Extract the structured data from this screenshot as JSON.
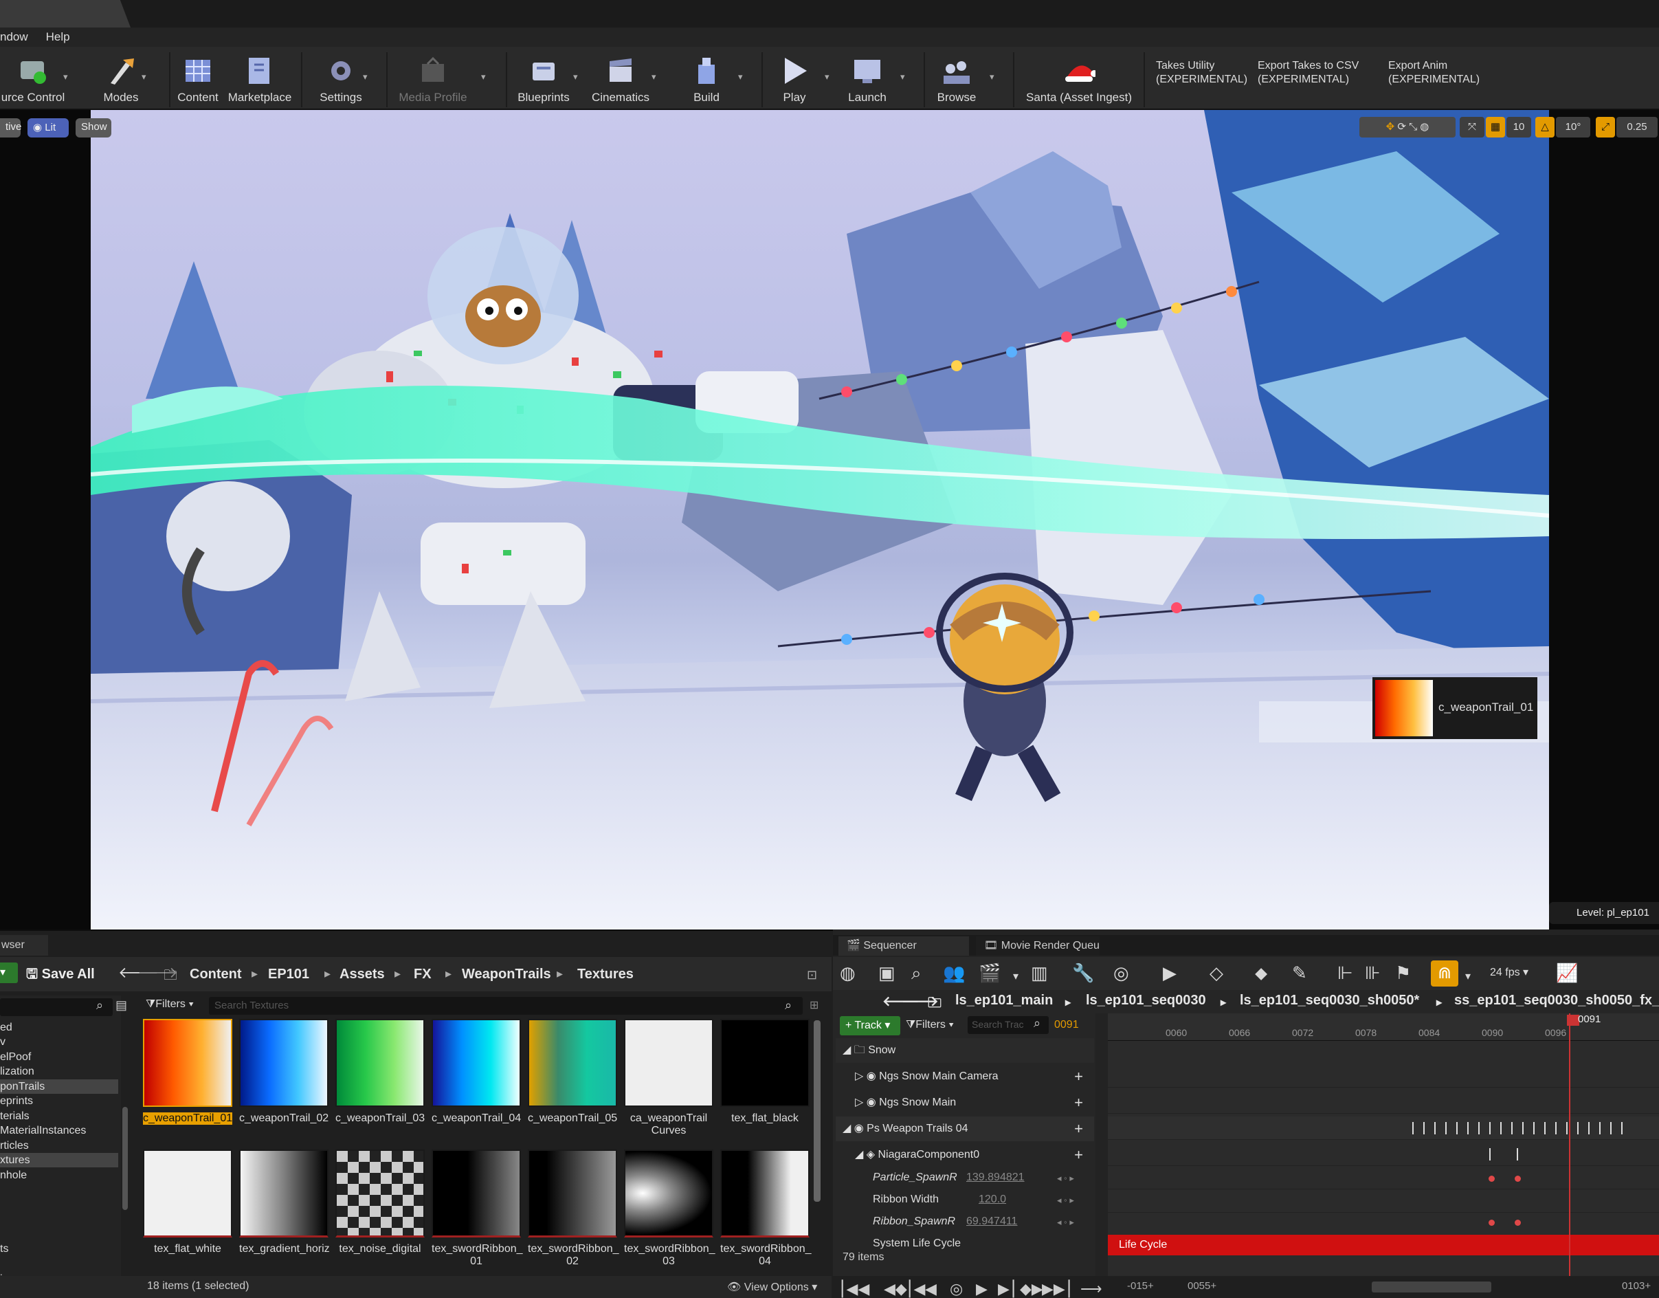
{
  "menu": {
    "window": "ndow",
    "help": "Help"
  },
  "toolbar": {
    "source_control": "urce Control",
    "modes": "Modes",
    "content": "Content",
    "marketplace": "Marketplace",
    "settings": "Settings",
    "media_profile": "Media Profile",
    "blueprints": "Blueprints",
    "cinematics": "Cinematics",
    "build": "Build",
    "play": "Play",
    "launch": "Launch",
    "browse": "Browse",
    "santa": "Santa (Asset Ingest)",
    "takes_utility_1": "Takes Utility",
    "takes_utility_2": "(EXPERIMENTAL)",
    "export_takes_1": "Export Takes to CSV",
    "export_takes_2": "(EXPERIMENTAL)",
    "export_anim_1": "Export Anim",
    "export_anim_2": "(EXPERIMENTAL)"
  },
  "viewport": {
    "perspective": "tive",
    "lit": "Lit",
    "show": "Show",
    "grid_snap": "10",
    "rot_snap": "10°",
    "scale_snap": "0.25",
    "level": "Level:  pl_ep101",
    "texture_preview": "c_weaponTrail_01"
  },
  "content_browser": {
    "tab": "wser",
    "save_all": "Save All",
    "breadcrumb": [
      "Content",
      "EP101",
      "Assets",
      "FX",
      "WeaponTrails",
      "Textures"
    ],
    "filters": "Filters",
    "search_placeholder": "Search Textures",
    "tree": [
      "ed",
      "v",
      "elPoof",
      "lization",
      "ponTrails",
      "eprints",
      "terials",
      "MaterialInstances",
      "rticles",
      "xtures",
      "nhole",
      "ts",
      "ics"
    ],
    "assets_row1": [
      "c_weaponTrail_01",
      "c_weaponTrail_02",
      "c_weaponTrail_03",
      "c_weaponTrail_04",
      "c_weaponTrail_05",
      "ca_weaponTrail",
      "tex_flat_black"
    ],
    "assets_row1_line2": [
      "",
      "",
      "",
      "",
      "",
      "Curves",
      ""
    ],
    "assets_row2": [
      "tex_flat_white",
      "tex_gradient_horiz",
      "tex_noise_digital",
      "tex_swordRibbon_",
      "tex_swordRibbon_",
      "tex_swordRibbon_",
      "tex_swordRibbon_"
    ],
    "assets_row2_line2": [
      "",
      "",
      "",
      "01",
      "02",
      "03",
      "04"
    ],
    "status": "18 items (1 selected)",
    "view_options": "View Options"
  },
  "sequencer": {
    "tab": "Sequencer",
    "tab2": "Movie Render Queue",
    "fps": "24 fps",
    "breadcrumb": [
      "ls_ep101_main",
      "ls_ep101_seq0030",
      "ls_ep101_seq0030_sh0050",
      "ss_ep101_seq0030_sh0050_fx_"
    ],
    "track": "Track",
    "filters": "Filters",
    "search_placeholder": "Search Trac",
    "frame": "0091",
    "rows": [
      "Snow",
      "Ngs Snow Main Camera",
      "Ngs Snow Main",
      "Ps Weapon Trails 04",
      "NiagaraComponent0"
    ],
    "props": [
      {
        "name": "Particle_SpawnR",
        "value": "139.894821"
      },
      {
        "name": "Ribbon Width",
        "value": "120.0"
      },
      {
        "name": "Ribbon_SpawnR",
        "value": "69.947411"
      },
      {
        "name": "System Life Cycle",
        "value": ""
      }
    ],
    "items": "79 items",
    "ruler": [
      "0060",
      "0066",
      "0072",
      "0078",
      "0084",
      "0090",
      "0096"
    ],
    "playhead": "0091",
    "life_cycle": "Life Cycle",
    "range_start": "-015",
    "range_mid": "0055",
    "range_end": "0103"
  }
}
